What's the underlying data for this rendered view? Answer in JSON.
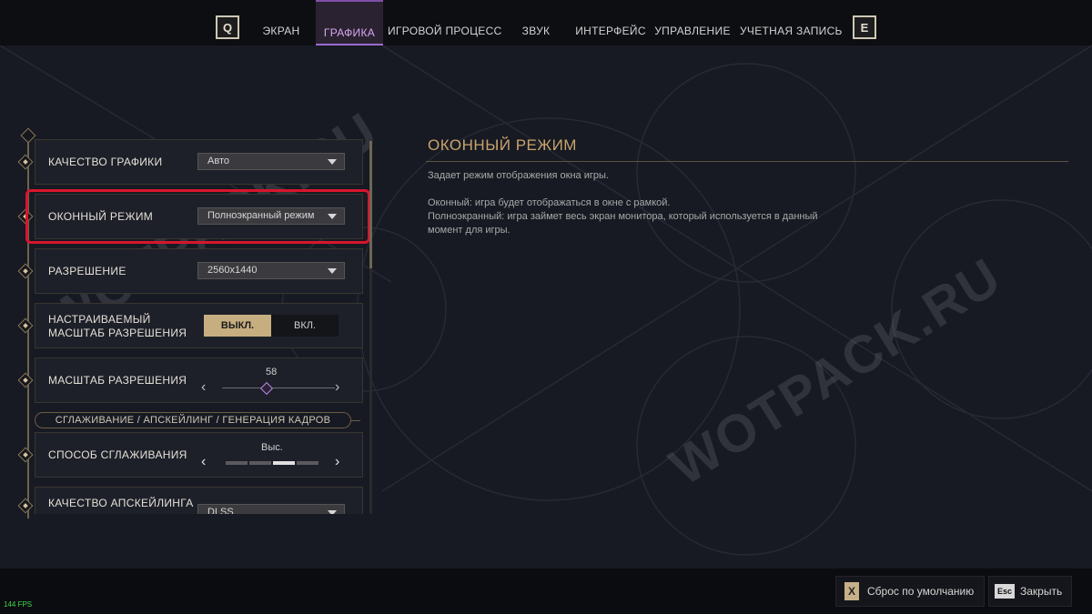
{
  "nav": {
    "prev_key": "Q",
    "next_key": "E",
    "tabs": [
      {
        "label": "ЭКРАН"
      },
      {
        "label": "ГРАФИКА"
      },
      {
        "label": "ИГРОВОЙ ПРОЦЕСС"
      },
      {
        "label": "ЗВУК"
      },
      {
        "label": "ИНТЕРФЕЙС"
      },
      {
        "label": "УПРАВЛЕНИЕ"
      },
      {
        "label": "УЧЕТНАЯ ЗАПИСЬ"
      }
    ],
    "active_tab": "ГРАФИКА"
  },
  "settings": {
    "graphics_quality": {
      "label": "КАЧЕСТВО ГРАФИКИ",
      "value": "Авто"
    },
    "window_mode": {
      "label": "ОКОННЫЙ РЕЖИМ",
      "value": "Полноэкранный режим"
    },
    "resolution": {
      "label": "РАЗРЕШЕНИЕ",
      "value": "2560x1440"
    },
    "custom_scale": {
      "label_line1": "НАСТРАИВАЕМЫЙ",
      "label_line2": "МАСШТАБ РАЗРЕШЕНИЯ",
      "off": "ВЫКЛ.",
      "on": "ВКЛ.",
      "selected": "ВЫКЛ."
    },
    "resolution_scale": {
      "label": "МАСШТАБ РАЗРЕШЕНИЯ",
      "value": "58"
    },
    "section_aa": "СГЛАЖИВАНИЕ / АПСКЕЙЛИНГ / ГЕНЕРАЦИЯ КАДРОВ",
    "aa_method": {
      "label": "СПОСОБ СГЛАЖИВАНИЯ",
      "value": "Выс.",
      "level": 3,
      "levels": 4
    },
    "upscaling_quality": {
      "label": "КАЧЕСТВО АПСКЕЙЛИНГА",
      "value": "DLSS"
    }
  },
  "detail": {
    "title": "ОКОННЫЙ РЕЖИМ",
    "description": "Задает режим отображения окна игры.",
    "line1": "Оконный: игра будет отображаться в окне с рамкой.",
    "line2": "Полноэкранный: игра займет весь экран монитора, который используется в данный",
    "line3": "момент для игры."
  },
  "watermark": "WOTPACK.RU",
  "footer": {
    "reset_key": "X",
    "reset_label": "Сброс по умолчанию",
    "close_key": "Esc",
    "close_label": "Закрыть"
  },
  "fps": "144 FPS",
  "colors": {
    "accent_gold": "#c9a46c",
    "active_tab": "#d7a8f0",
    "highlight": "#d8152d"
  }
}
